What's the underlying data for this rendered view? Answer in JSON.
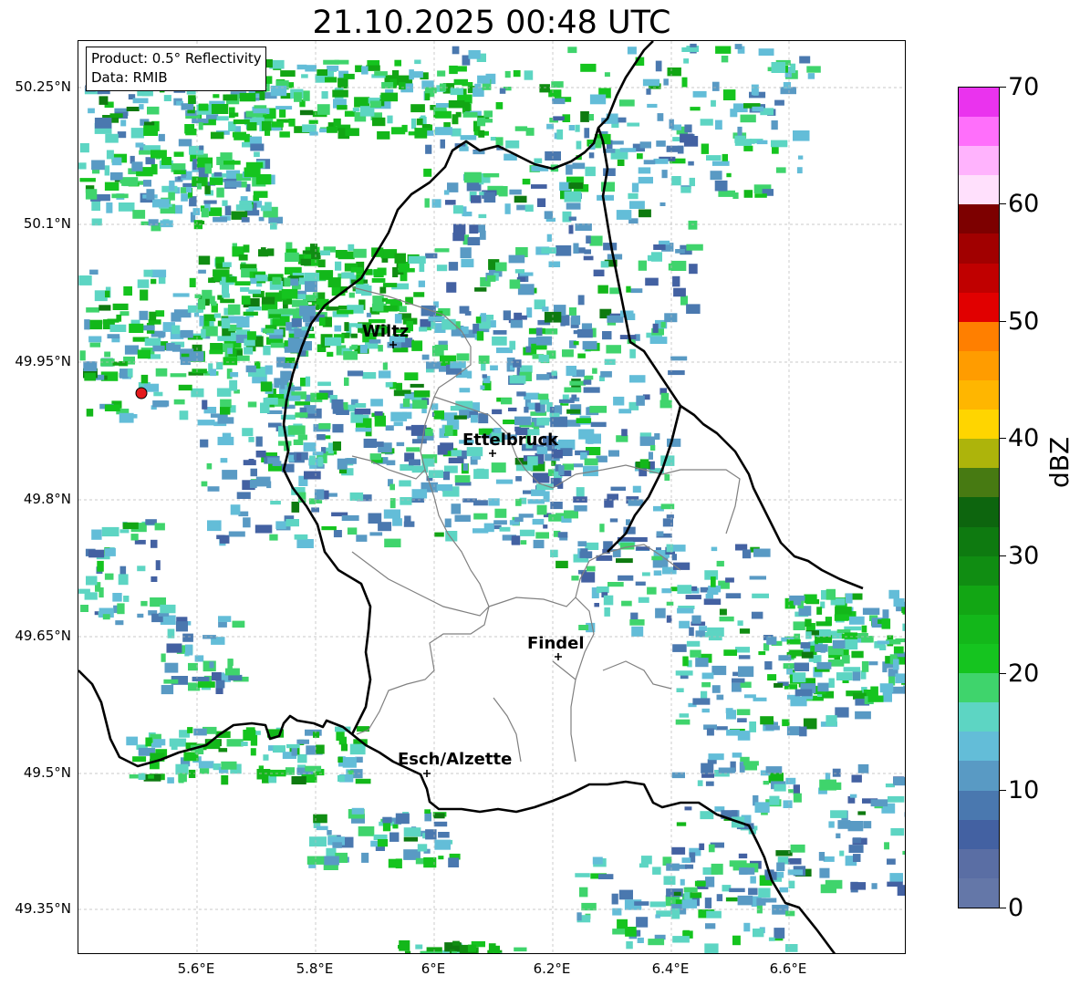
{
  "title": "21.10.2025 00:48 UTC",
  "product_box": {
    "product": "Product: 0.5° Reflectivity",
    "data_source": "Data: RMIB"
  },
  "latitude_labels": [
    "50.25°N",
    "50.1°N",
    "49.95°N",
    "49.8°N",
    "49.65°N",
    "49.5°N",
    "49.35°N"
  ],
  "longitude_labels": [
    "5.6°E",
    "5.8°E",
    "6°E",
    "6.2°E",
    "6.4°E",
    "6.6°E"
  ],
  "cities": [
    {
      "name": "Wiltz"
    },
    {
      "name": "Ettelbruck"
    },
    {
      "name": "Findel"
    },
    {
      "name": "Esch/Alzette"
    }
  ],
  "colorbar": {
    "label": "dBZ",
    "tick_labels": [
      "0",
      "10",
      "20",
      "30",
      "40",
      "50",
      "60",
      "70"
    ],
    "range": [
      0,
      70
    ],
    "step": 2.5,
    "colors": [
      "#6477a8",
      "#5a6ea4",
      "#4361a2",
      "#4a78af",
      "#599ac4",
      "#63bdd8",
      "#5dd5c3",
      "#3fd46c",
      "#15c41f",
      "#13b71a",
      "#12a614",
      "#108d12",
      "#0e7a10",
      "#0d650e",
      "#477a12",
      "#adb40b",
      "#ffd500",
      "#ffb600",
      "#ff9c00",
      "#ff7f00",
      "#e10000",
      "#c00000",
      "#a10000",
      "#7d0000",
      "#ffe0fc",
      "#ffb3fd",
      "#ff6ffb",
      "#ea33ee"
    ]
  },
  "radar_site_color": "#e31a1c",
  "border_color": "#000000"
}
